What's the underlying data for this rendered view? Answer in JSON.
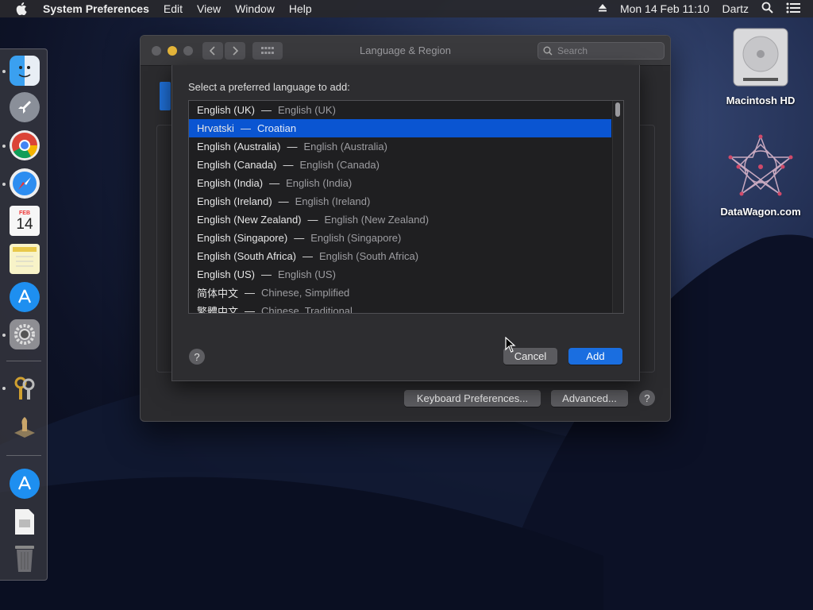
{
  "menubar": {
    "app_name": "System Preferences",
    "menus": [
      "Edit",
      "View",
      "Window",
      "Help"
    ],
    "datetime": "Mon 14 Feb  11:10",
    "user": "Dartz"
  },
  "desktop": {
    "icons": [
      {
        "label": "Macintosh HD",
        "icon": "hard-drive-icon"
      },
      {
        "label": "DataWagon.com",
        "icon": "datawagon-logo-icon"
      }
    ]
  },
  "dock": {
    "calendar_month": "FEB",
    "calendar_day": "14"
  },
  "window": {
    "title": "Language & Region",
    "search_placeholder": "Search",
    "keyboard_prefs_label": "Keyboard Preferences...",
    "advanced_label": "Advanced...",
    "help_label": "?"
  },
  "sheet": {
    "title": "Select a preferred language to add:",
    "languages": [
      {
        "native": "English (UK)",
        "english": "English (UK)",
        "selected": false
      },
      {
        "native": "Hrvatski",
        "english": "Croatian",
        "selected": true
      },
      {
        "native": "English (Australia)",
        "english": "English (Australia)",
        "selected": false
      },
      {
        "native": "English (Canada)",
        "english": "English (Canada)",
        "selected": false
      },
      {
        "native": "English (India)",
        "english": "English (India)",
        "selected": false
      },
      {
        "native": "English (Ireland)",
        "english": "English (Ireland)",
        "selected": false
      },
      {
        "native": "English (New Zealand)",
        "english": "English (New Zealand)",
        "selected": false
      },
      {
        "native": "English (Singapore)",
        "english": "English (Singapore)",
        "selected": false
      },
      {
        "native": "English (South Africa)",
        "english": "English (South Africa)",
        "selected": false
      },
      {
        "native": "English (US)",
        "english": "English (US)",
        "selected": false
      },
      {
        "native": "简体中文",
        "english": "Chinese, Simplified",
        "selected": false
      },
      {
        "native": "繁體中文",
        "english": "Chinese, Traditional",
        "selected": false
      }
    ],
    "separator": "—",
    "help_label": "?",
    "cancel_label": "Cancel",
    "add_label": "Add"
  },
  "colors": {
    "selection": "#0a55d2",
    "default_button": "#1a6ee0"
  }
}
